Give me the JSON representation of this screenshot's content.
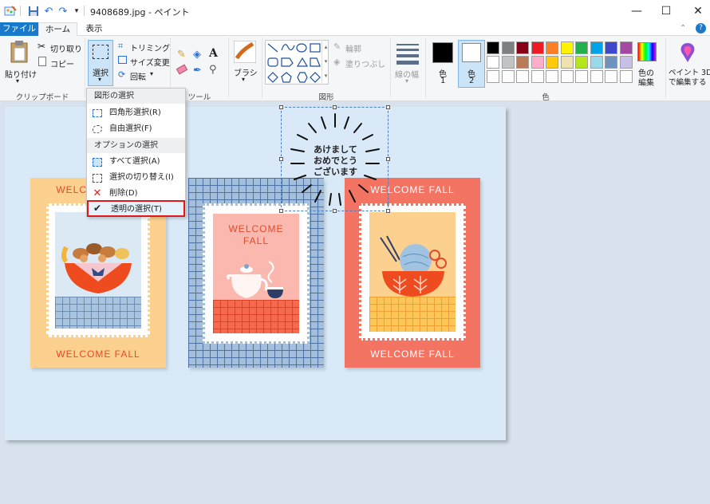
{
  "title_bar": {
    "title": "9408689.jpg - ペイント",
    "minimize": "—",
    "maximize": "☐",
    "close": "✕"
  },
  "tabs": {
    "file": "ファイル",
    "home": "ホーム",
    "view": "表示"
  },
  "ribbon": {
    "clipboard": {
      "paste": "貼り付け",
      "cut": "切り取り",
      "copy": "コピー",
      "group": "クリップボード"
    },
    "image": {
      "select": "選択",
      "crop": "トリミング",
      "resize": "サイズ変更",
      "rotate": "回転"
    },
    "tools": {
      "group": "ツール",
      "text_glyph": "A"
    },
    "brush": "ブラシ",
    "shapes": {
      "group": "図形",
      "outline": "輪郭",
      "fill": "塗りつぶし"
    },
    "size": "線の幅",
    "colors": {
      "color1_a": "色",
      "color1_b": "1",
      "color2_a": "色",
      "color2_b": "2",
      "group": "色",
      "edit_a": "色の",
      "edit_b": "編集",
      "primary": "#000000",
      "secondary": "#ffffff",
      "palette": [
        "#000000",
        "#7f7f7f",
        "#880015",
        "#ed1c24",
        "#ff7f27",
        "#fff200",
        "#22b14c",
        "#00a2e8",
        "#3f48cc",
        "#a349a4",
        "#ffffff",
        "#c3c3c3",
        "#b97a57",
        "#ffaec9",
        "#ffc90e",
        "#efe4b0",
        "#b5e61d",
        "#99d9ea",
        "#7092be",
        "#c8bfe7",
        "#ffffff",
        "#ffffff",
        "#ffffff",
        "#ffffff",
        "#ffffff",
        "#ffffff",
        "#ffffff",
        "#ffffff",
        "#ffffff",
        "#ffffff"
      ]
    },
    "paint3d_a": "ペイント 3D",
    "paint3d_b": "で編集する"
  },
  "dropdown": {
    "header_shape": "図形の選択",
    "rect_select": "四角形選択(R)",
    "free_select": "自由選択(F)",
    "header_options": "オプションの選択",
    "select_all": "すべて選択(A)",
    "invert": "選択の切り替え(I)",
    "delete": "削除(D)",
    "transparent": "透明の選択(T)"
  },
  "canvas": {
    "card1_top": "WELCOME FALL",
    "card1_bottom": "WELCOME FALL",
    "card2_title_a": "WELCOME",
    "card2_title_b": "FALL",
    "card3_top": "WELCOME FALL",
    "card3_bottom": "WELCOME FALL",
    "greeting_1": "あけまして",
    "greeting_2": "おめでとう",
    "greeting_3": "ございます"
  }
}
